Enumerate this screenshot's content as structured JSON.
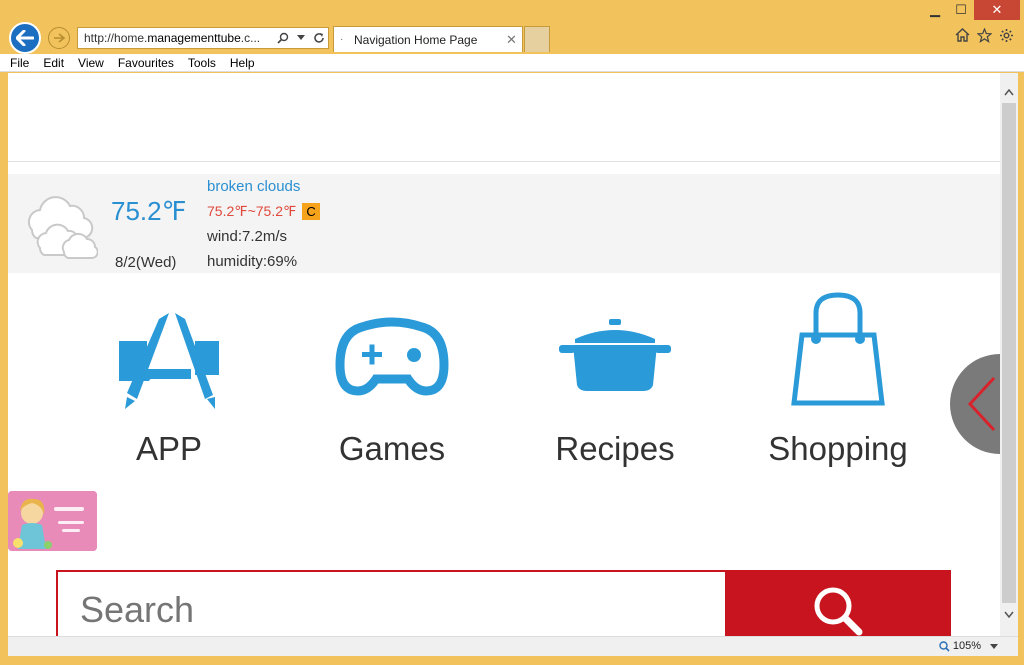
{
  "window": {
    "minimize": "▁",
    "maximize": "☐",
    "close": "✕"
  },
  "address_bar": {
    "url_prefix": "http://home.",
    "url_domain": "managementtube",
    "url_suffix": ".c..."
  },
  "tab": {
    "title": "Navigation Home Page",
    "close": "✕"
  },
  "menu": [
    "File",
    "Edit",
    "View",
    "Favourites",
    "Tools",
    "Help"
  ],
  "weather": {
    "temperature": "75.2℉",
    "date": "8/2(Wed)",
    "description": "broken clouds",
    "range": "75.2℉~75.2℉",
    "unit_toggle": "C",
    "wind": "wind:7.2m/s",
    "humidity": "humidity:69%"
  },
  "tiles": [
    {
      "label": "APP",
      "icon": "app-store-icon"
    },
    {
      "label": "Games",
      "icon": "gamepad-icon"
    },
    {
      "label": "Recipes",
      "icon": "cooking-pot-icon"
    },
    {
      "label": "Shopping",
      "icon": "shopping-bag-icon"
    }
  ],
  "search": {
    "placeholder": "Search"
  },
  "status": {
    "zoom": "105%"
  },
  "colors": {
    "accent_blue": "#2a8fd1",
    "tile_icon": "#2a9ad8",
    "search_red": "#c8141f",
    "chrome": "#f2c35c"
  }
}
